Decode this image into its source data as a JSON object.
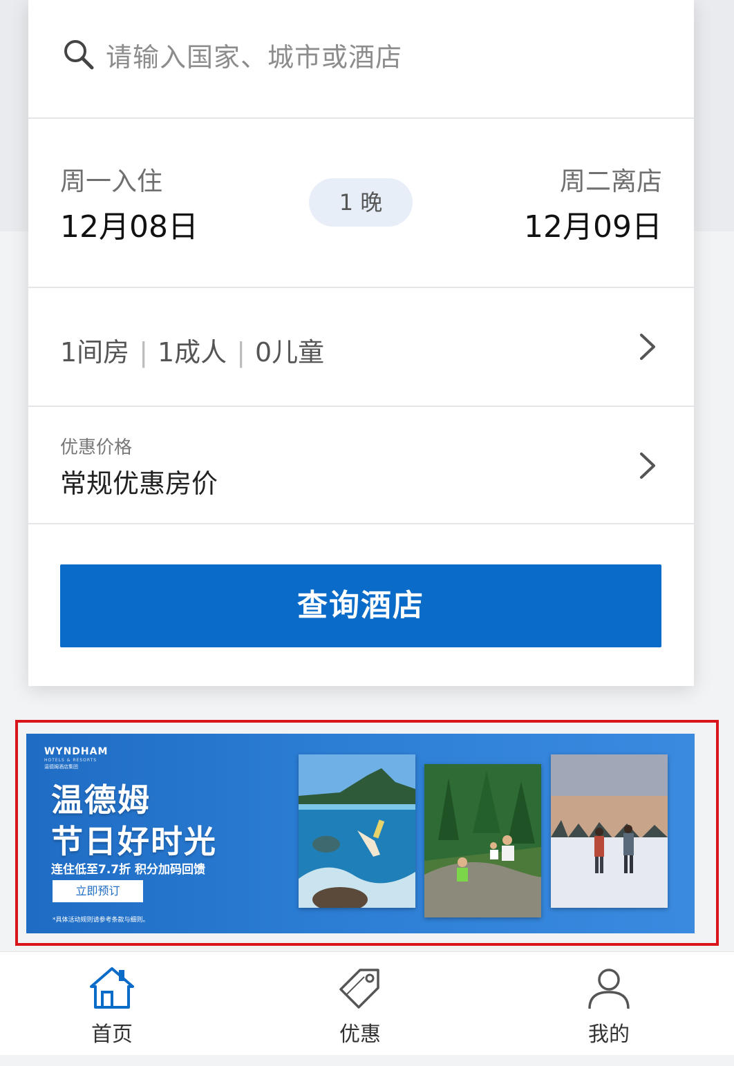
{
  "search": {
    "placeholder": "请输入国家、城市或酒店",
    "icon": "search-icon"
  },
  "dates": {
    "checkin_label": "周一入住",
    "checkin_date": "12月08日",
    "nights": "1 晚",
    "checkout_label": "周二离店",
    "checkout_date": "12月09日"
  },
  "guests": {
    "rooms": "1间房",
    "adults": "1成人",
    "children": "0儿童",
    "separator": "|"
  },
  "rate": {
    "label": "优惠价格",
    "value": "常规优惠房价"
  },
  "search_button": "查询酒店",
  "banner": {
    "brand": "WYNDHAM",
    "brand_sub": "HOTELS & RESORTS",
    "brand_cn": "温德姆酒店集团",
    "title_line1": "温德姆",
    "title_line2": "节日好时光",
    "subtitle": "连住低至7.7折 积分加码回馈",
    "cta": "立即预订",
    "note": "*具体活动规则请参考条款与细则。",
    "highlight_color": "#d9141b",
    "background_color": "#2d7fd6"
  },
  "nav": {
    "items": [
      {
        "label": "首页",
        "icon": "home-icon",
        "active": true
      },
      {
        "label": "优惠",
        "icon": "tag-icon",
        "active": false
      },
      {
        "label": "我的",
        "icon": "user-icon",
        "active": false
      }
    ],
    "active_color": "#0b6bc8"
  },
  "colors": {
    "primary": "#0b6bc8",
    "pill_bg": "#e7eef8"
  }
}
